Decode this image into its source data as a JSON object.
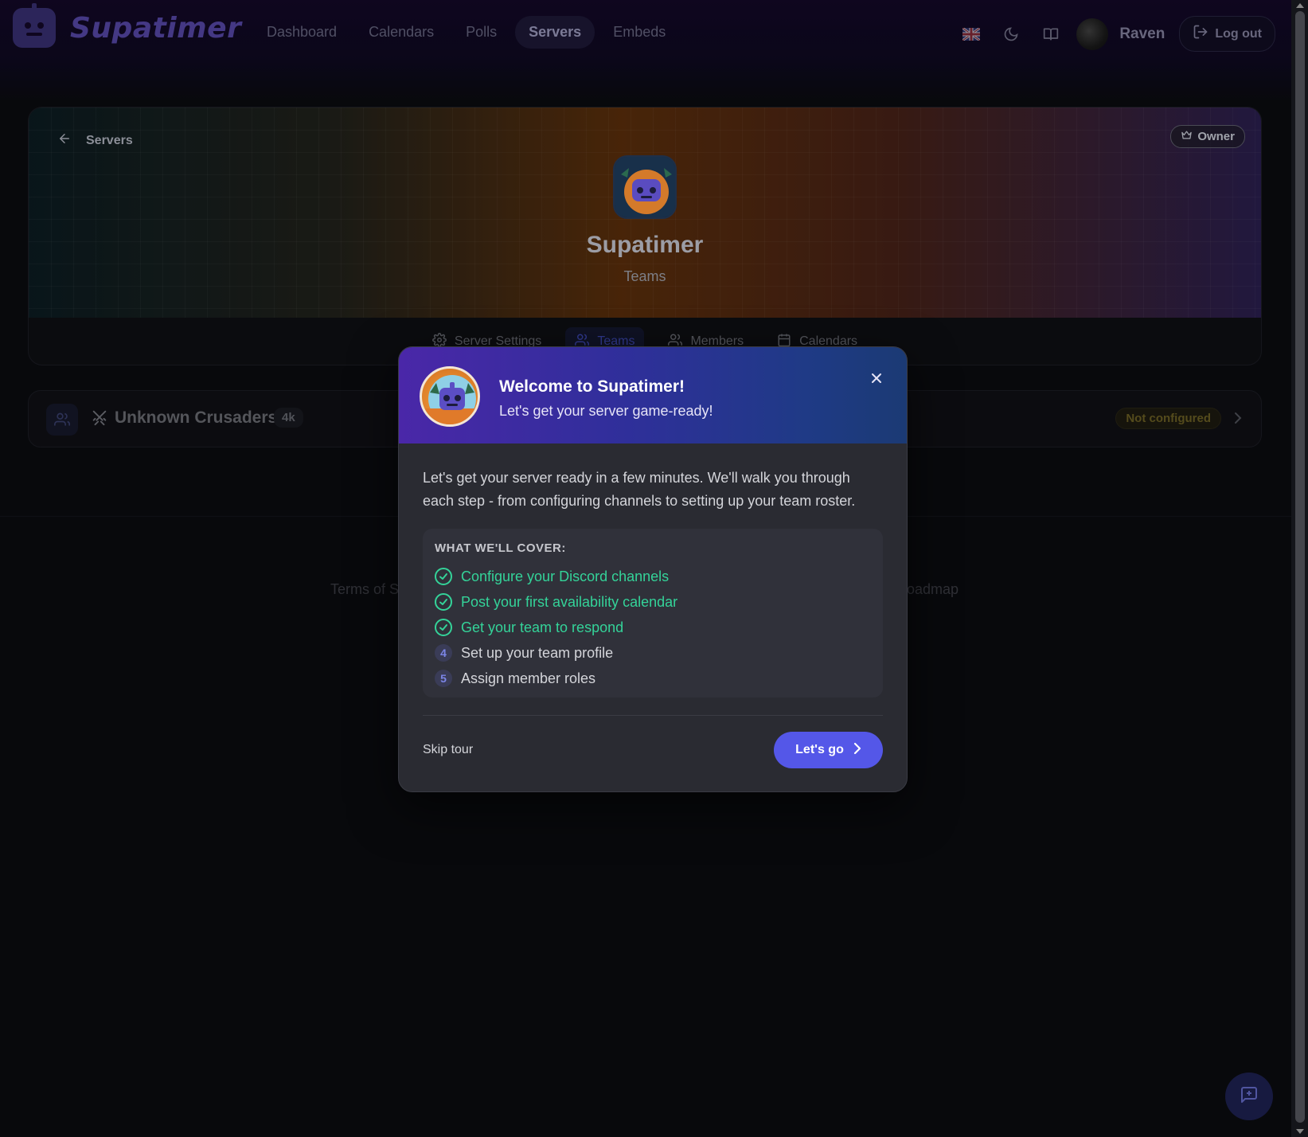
{
  "app": {
    "brand_name": "Supatimer",
    "accent_color": "#5457e8"
  },
  "nav": {
    "items": [
      {
        "label": "Dashboard",
        "active": false
      },
      {
        "label": "Calendars",
        "active": false
      },
      {
        "label": "Polls",
        "active": false
      },
      {
        "label": "Servers",
        "active": true
      },
      {
        "label": "Embeds",
        "active": false
      }
    ],
    "user": {
      "name": "Raven"
    },
    "logout_label": "Log out",
    "icons": [
      "uk-flag-icon",
      "moon-icon",
      "book-icon"
    ]
  },
  "server": {
    "back_label": "Servers",
    "owner_label": "Owner",
    "name": "Supatimer",
    "subtitle": "Teams",
    "tabs": [
      {
        "label": "Server Settings",
        "icon": "gear-icon",
        "active": false
      },
      {
        "label": "Teams",
        "icon": "users-icon",
        "active": true
      },
      {
        "label": "Members",
        "icon": "users-icon",
        "active": false
      },
      {
        "label": "Calendars",
        "icon": "calendar-icon",
        "active": false
      }
    ]
  },
  "team": {
    "name": "Unknown Crusaders",
    "count": "4k",
    "status": "Not configured"
  },
  "footer": {
    "left_partial": "Terms of S",
    "right_partial": "oadmap"
  },
  "modal": {
    "title": "Welcome to Supatimer!",
    "subtitle": "Let's get your server game-ready!",
    "body": "Let's get your server ready in a few minutes. We'll walk you through each step - from configuring channels to setting up your team roster.",
    "cover_title": "WHAT WE'LL COVER:",
    "steps": [
      {
        "label": "Configure your Discord channels",
        "done": true
      },
      {
        "label": "Post your first availability calendar",
        "done": true
      },
      {
        "label": "Get your team to respond",
        "done": true
      },
      {
        "label": "Set up your team profile",
        "done": false,
        "number": "4"
      },
      {
        "label": "Assign member roles",
        "done": false,
        "number": "5"
      }
    ],
    "skip_label": "Skip tour",
    "cta_label": "Let's go"
  }
}
